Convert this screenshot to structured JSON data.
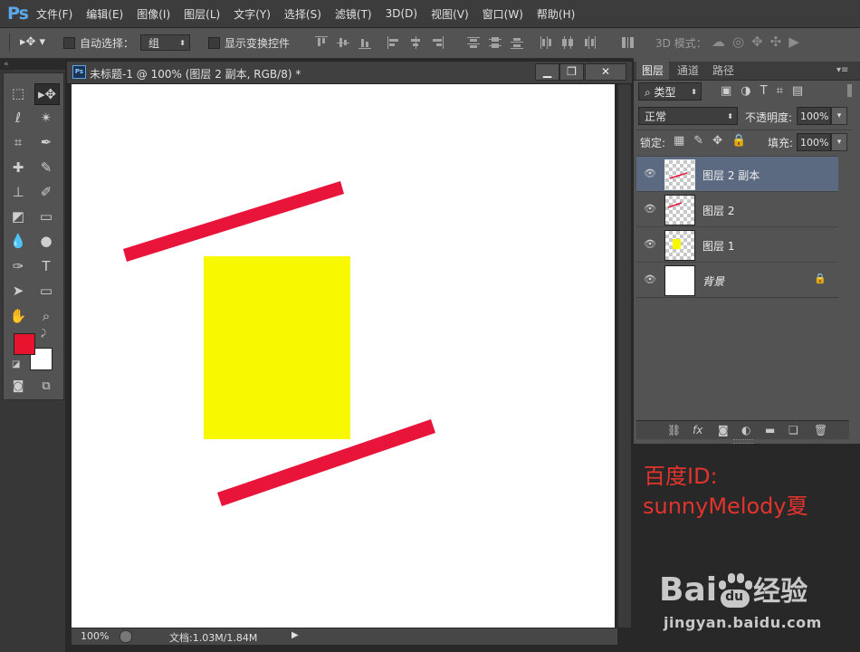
{
  "app": {
    "logo": "Ps"
  },
  "menu": [
    "文件(F)",
    "编辑(E)",
    "图像(I)",
    "图层(L)",
    "文字(Y)",
    "选择(S)",
    "滤镜(T)",
    "3D(D)",
    "视图(V)",
    "窗口(W)",
    "帮助(H)"
  ],
  "options": {
    "auto_select_label": "自动选择：",
    "auto_select_value": "组",
    "show_transform_label": "显示变换控件",
    "mode_3d_label": "3D 模式："
  },
  "document": {
    "title": "未标题-1 @ 100% (图层 2 副本, RGB/8) *",
    "zoom": "100%",
    "doc_info": "文档:1.03M/1.84M"
  },
  "colors": {
    "foreground": "#e8142e",
    "background": "#ffffff",
    "yellow": "#f8f800",
    "red": "#e8143a"
  },
  "layers_panel": {
    "tabs": [
      "图层",
      "通道",
      "路径"
    ],
    "filter_label": "类型",
    "blend_mode": "正常",
    "opacity_label": "不透明度:",
    "opacity_value": "100%",
    "lock_label": "锁定:",
    "fill_label": "填充:",
    "fill_value": "100%",
    "layers": [
      {
        "name": "图层 2 副本",
        "selected": true
      },
      {
        "name": "图层 2",
        "selected": false
      },
      {
        "name": "图层 1",
        "selected": false
      },
      {
        "name": "背景",
        "selected": false,
        "locked": true
      }
    ]
  },
  "watermark": {
    "id_line1": "百度ID:",
    "id_line2": "sunnyMelody夏",
    "baidu_text": "Bai",
    "baidu_du": "du",
    "baidu_jy": "经验",
    "url": "jingyan.baidu.com"
  }
}
